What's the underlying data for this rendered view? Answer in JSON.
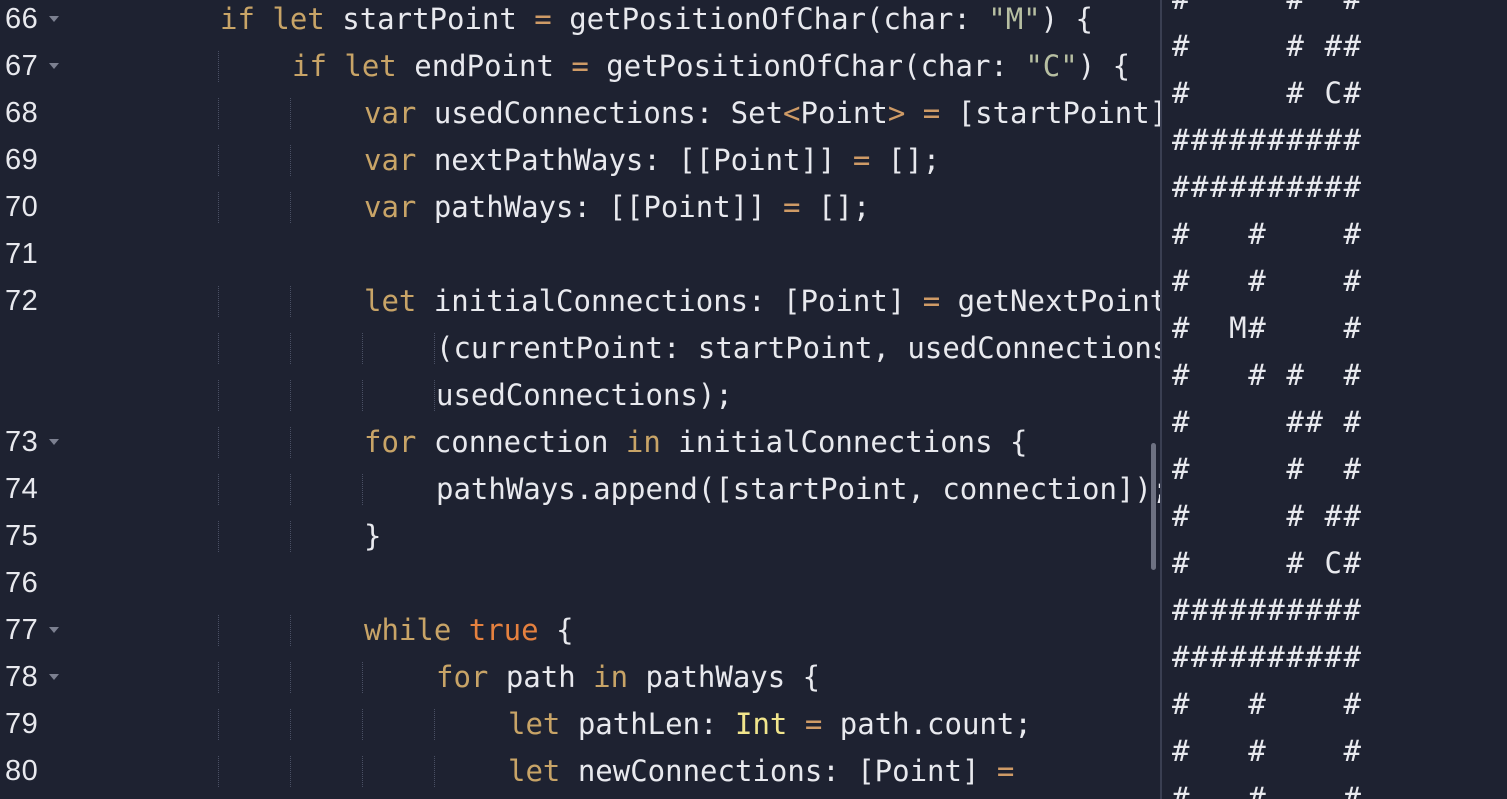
{
  "editor": {
    "lines": [
      {
        "num": "66",
        "fold": true,
        "indent": 2,
        "tokens": [
          {
            "t": "if ",
            "c": "kw"
          },
          {
            "t": "let ",
            "c": "kw"
          },
          {
            "t": "startPoint ",
            "c": "plain"
          },
          {
            "t": "= ",
            "c": "op"
          },
          {
            "t": "getPositionOfChar(char: ",
            "c": "plain"
          },
          {
            "t": "\"M\"",
            "c": "str"
          },
          {
            "t": ") {",
            "c": "plain"
          }
        ]
      },
      {
        "num": "67",
        "fold": true,
        "indent": 3,
        "tokens": [
          {
            "t": "if ",
            "c": "kw"
          },
          {
            "t": "let ",
            "c": "kw"
          },
          {
            "t": "endPoint ",
            "c": "plain"
          },
          {
            "t": "= ",
            "c": "op"
          },
          {
            "t": "getPositionOfChar(char: ",
            "c": "plain"
          },
          {
            "t": "\"C\"",
            "c": "str"
          },
          {
            "t": ") {",
            "c": "plain"
          }
        ]
      },
      {
        "num": "68",
        "fold": false,
        "indent": 4,
        "tokens": [
          {
            "t": "var ",
            "c": "kw"
          },
          {
            "t": "usedConnections: Set",
            "c": "plain"
          },
          {
            "t": "<",
            "c": "op"
          },
          {
            "t": "Point",
            "c": "plain"
          },
          {
            "t": "> ",
            "c": "op"
          },
          {
            "t": "= ",
            "c": "op"
          },
          {
            "t": "[startPoint];",
            "c": "plain"
          }
        ]
      },
      {
        "num": "69",
        "fold": false,
        "indent": 4,
        "tokens": [
          {
            "t": "var ",
            "c": "kw"
          },
          {
            "t": "nextPathWays: [[Point]] ",
            "c": "plain"
          },
          {
            "t": "= ",
            "c": "op"
          },
          {
            "t": "[];",
            "c": "plain"
          }
        ]
      },
      {
        "num": "70",
        "fold": false,
        "indent": 4,
        "tokens": [
          {
            "t": "var ",
            "c": "kw"
          },
          {
            "t": "pathWays: [[Point]] ",
            "c": "plain"
          },
          {
            "t": "= ",
            "c": "op"
          },
          {
            "t": "[];",
            "c": "plain"
          }
        ]
      },
      {
        "num": "71",
        "fold": false,
        "indent": 0,
        "tokens": []
      },
      {
        "num": "72",
        "fold": false,
        "indent": 4,
        "tokens": [
          {
            "t": "let ",
            "c": "kw"
          },
          {
            "t": "initialConnections: [Point] ",
            "c": "plain"
          },
          {
            "t": "= ",
            "c": "op"
          },
          {
            "t": "getNextPoints",
            "c": "plain"
          }
        ]
      },
      {
        "num": "",
        "fold": false,
        "indent": 5,
        "guides": 4,
        "tokens": [
          {
            "t": "(currentPoint: startPoint, usedConnections:",
            "c": "plain"
          }
        ]
      },
      {
        "num": "",
        "fold": false,
        "indent": 5,
        "guides": 4,
        "tokens": [
          {
            "t": "usedConnections);",
            "c": "plain"
          }
        ]
      },
      {
        "num": "73",
        "fold": true,
        "indent": 4,
        "tokens": [
          {
            "t": "for ",
            "c": "kw"
          },
          {
            "t": "connection ",
            "c": "plain"
          },
          {
            "t": "in ",
            "c": "kw"
          },
          {
            "t": "initialConnections {",
            "c": "plain"
          }
        ]
      },
      {
        "num": "74",
        "fold": false,
        "indent": 5,
        "tokens": [
          {
            "t": "pathWays.append([startPoint, connection]);",
            "c": "plain"
          }
        ]
      },
      {
        "num": "75",
        "fold": false,
        "indent": 4,
        "tokens": [
          {
            "t": "}",
            "c": "plain"
          }
        ]
      },
      {
        "num": "76",
        "fold": false,
        "indent": 0,
        "tokens": []
      },
      {
        "num": "77",
        "fold": true,
        "indent": 4,
        "tokens": [
          {
            "t": "while ",
            "c": "kw"
          },
          {
            "t": "true ",
            "c": "kw2"
          },
          {
            "t": "{",
            "c": "plain"
          }
        ]
      },
      {
        "num": "78",
        "fold": true,
        "indent": 5,
        "tokens": [
          {
            "t": "for ",
            "c": "kw"
          },
          {
            "t": "path ",
            "c": "plain"
          },
          {
            "t": "in ",
            "c": "kw"
          },
          {
            "t": "pathWays {",
            "c": "plain"
          }
        ]
      },
      {
        "num": "79",
        "fold": false,
        "indent": 6,
        "tokens": [
          {
            "t": "let ",
            "c": "kw"
          },
          {
            "t": "pathLen: ",
            "c": "plain"
          },
          {
            "t": "Int ",
            "c": "typ"
          },
          {
            "t": "= ",
            "c": "op"
          },
          {
            "t": "path.count;",
            "c": "plain"
          }
        ]
      },
      {
        "num": "80",
        "fold": false,
        "indent": 6,
        "tokens": [
          {
            "t": "let ",
            "c": "kw"
          },
          {
            "t": "newConnections: [Point] ",
            "c": "plain"
          },
          {
            "t": "=",
            "c": "op"
          }
        ]
      }
    ]
  },
  "console": {
    "lines": [
      "#     #  #",
      "#     # ##",
      "#     # C#",
      "##########",
      "##########",
      "#   #    #",
      "#   #    #",
      "#  M#    #",
      "#   # #  #",
      "#     ## #",
      "#     #  #",
      "#     # ##",
      "#     # C#",
      "##########",
      "##########",
      "#   #    #",
      "#   #    #",
      "#   #    #"
    ]
  },
  "colors": {
    "background": "#1e2231",
    "keyword": "#c8a467",
    "keyword_literal": "#e5813f",
    "string": "#b7bfa2",
    "type": "#f1e58c",
    "operator": "#cf9b66",
    "text": "#e8e9ee"
  },
  "icons": {
    "fold_marker": "chevron-down-icon"
  }
}
